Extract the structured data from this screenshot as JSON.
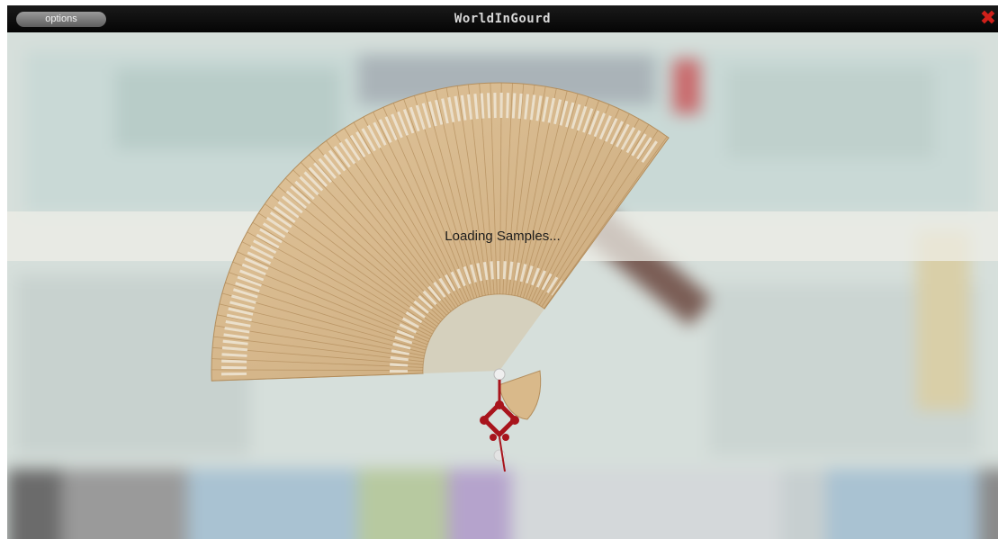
{
  "window": {
    "title": "WorldInGourd",
    "options_label": "options",
    "close_label": "✖"
  },
  "loading": {
    "message": "Loading Samples..."
  },
  "colors": {
    "titlebar": "#0d0d0d",
    "close": "#d0201a",
    "fan": "#d8b889",
    "knot": "#a8141c"
  },
  "icons": [
    "close-icon",
    "fan-illustration",
    "chinese-knot-tassel"
  ]
}
